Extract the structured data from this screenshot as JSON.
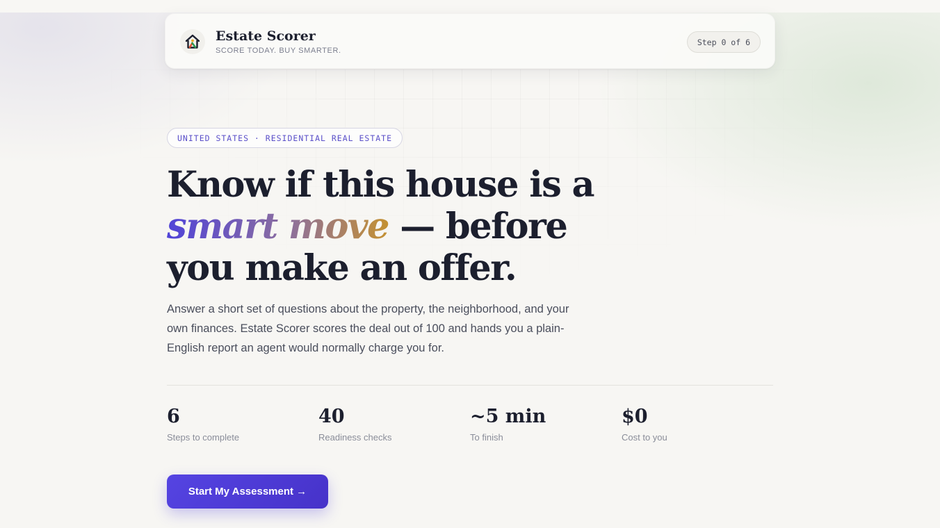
{
  "header": {
    "brand_name": "Estate Scorer",
    "tagline": "SCORE TODAY. BUY SMARTER.",
    "step_indicator": "Step 0 of 6",
    "logo_icon": "house-icon"
  },
  "hero": {
    "badge": "UNITED STATES · RESIDENTIAL REAL ESTATE",
    "headline_part1": "Know if this house is a ",
    "headline_accent": "smart move",
    "headline_part2": " — before you make an offer.",
    "description": "Answer a short set of questions about the property, the neighborhood, and your own finances. Estate Scorer scores the deal out of 100 and hands you a plain-English report an agent would normally charge you for."
  },
  "stats": [
    {
      "value": "6",
      "label": "Steps to complete"
    },
    {
      "value": "40",
      "label": "Readiness checks"
    },
    {
      "value": "~5 min",
      "label": "To finish"
    },
    {
      "value": "$0",
      "label": "Cost to you"
    }
  ],
  "cta": {
    "label": "Start My Assessment →"
  },
  "colors": {
    "accent": "#4f3fd8",
    "accent_gold": "#c49132",
    "background": "#f7f6f3",
    "text_primary": "#1c1f2e"
  }
}
